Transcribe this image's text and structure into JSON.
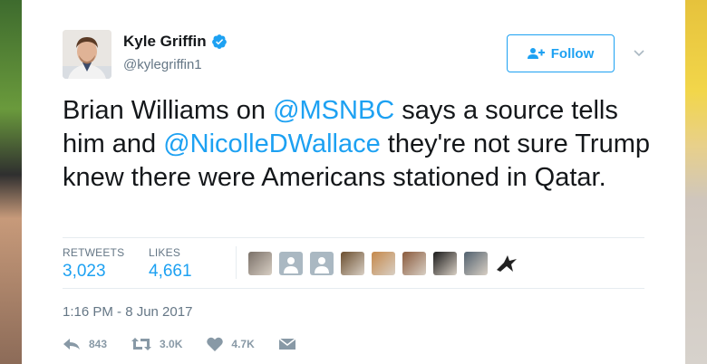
{
  "author": {
    "name": "Kyle Griffin",
    "handle": "@kylegriffin1",
    "verified": true
  },
  "follow_button": {
    "label": "Follow"
  },
  "tweet": {
    "segments": [
      {
        "text": "Brian Williams on ",
        "mention": false
      },
      {
        "text": "@MSNBC",
        "mention": true
      },
      {
        "text": " says a source tells him and ",
        "mention": false
      },
      {
        "text": "@NicolleDWallace",
        "mention": true
      },
      {
        "text": " they're not sure Trump knew there were Americans stationed in Qatar.",
        "mention": false
      }
    ]
  },
  "stats": {
    "retweets_label": "RETWEETS",
    "retweets_value": "3,023",
    "likes_label": "LIKES",
    "likes_value": "4,661"
  },
  "likers": [
    {
      "icon": "photo-avatar",
      "color": "#7a7068"
    },
    {
      "icon": "default-avatar",
      "color": "#aab8c2"
    },
    {
      "icon": "default-avatar",
      "color": "#aab8c2"
    },
    {
      "icon": "photo-avatar",
      "color": "#6b4e2e"
    },
    {
      "icon": "photo-avatar",
      "color": "#c5884a"
    },
    {
      "icon": "photo-avatar",
      "color": "#8a5a3c"
    },
    {
      "icon": "photo-avatar",
      "color": "#1a1a1a"
    },
    {
      "icon": "photo-avatar",
      "color": "#50606e"
    },
    {
      "icon": "bird-avatar",
      "color": "#222222"
    }
  ],
  "timestamp": "1:16 PM - 8 Jun 2017",
  "actions": {
    "reply_count": "843",
    "retweet_count": "3.0K",
    "like_count": "4.7K"
  },
  "colors": {
    "accent": "#1da1f2",
    "text": "#14171a",
    "muted": "#657786"
  }
}
